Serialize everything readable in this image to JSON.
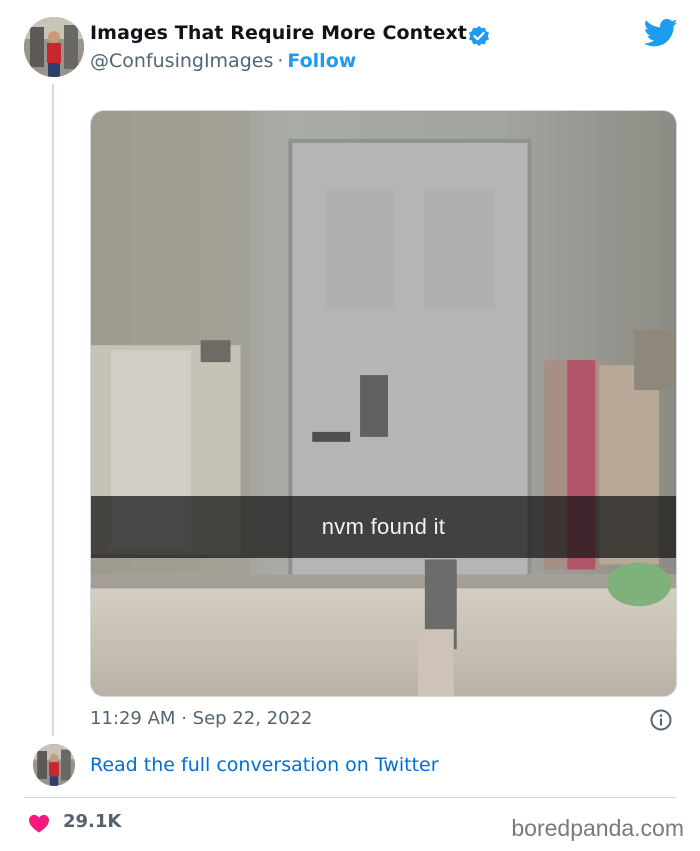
{
  "tweet": {
    "display_name": "Images That Require More Context",
    "handle": "@ConfusingImages",
    "separator": "·",
    "follow_label": "Follow",
    "media_caption": "nvm found it",
    "time": "11:29 AM",
    "date": "Sep 22, 2022",
    "read_conversation_label": "Read the full conversation on Twitter",
    "like_count": "29.1K"
  },
  "watermark": "boredpanda.com",
  "colors": {
    "accent": "#1d9bf0",
    "link": "#006fd6",
    "heart": "#f91880",
    "muted_text": "#536471"
  },
  "icons": {
    "verified": "verified-badge-icon",
    "brand": "twitter-bird-icon",
    "info": "info-icon",
    "like": "heart-icon"
  }
}
